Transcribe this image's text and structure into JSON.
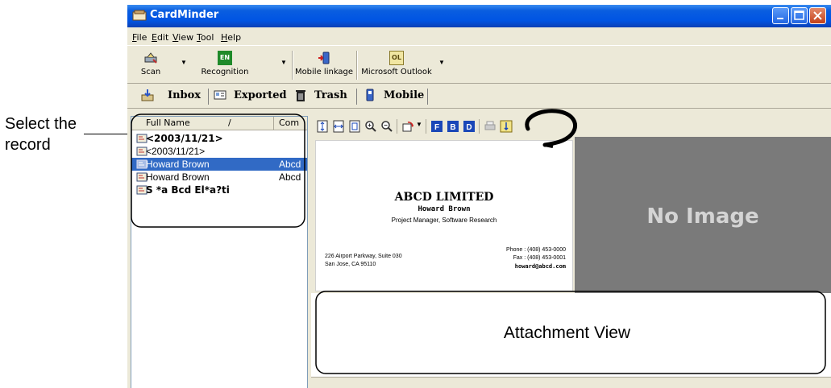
{
  "callout": {
    "label": "Select the record"
  },
  "window": {
    "title": "CardMinder"
  },
  "menu": [
    "File",
    "Edit",
    "View",
    "Tool",
    "Help"
  ],
  "toolbar": {
    "scan": "Scan",
    "recognition": "Recognition",
    "mobile_linkage": "Mobile linkage",
    "outlook": "Microsoft Outlook",
    "recognition_icon_text": "EN",
    "outlook_icon_text": "OL"
  },
  "tabs": [
    "Inbox",
    "Exported",
    "Trash",
    "Mobile"
  ],
  "list": {
    "columns": [
      "Full Name",
      "Com"
    ],
    "rows": [
      {
        "name": "<2003/11/21>",
        "company": "",
        "bold": true
      },
      {
        "name": "<2003/11/21>",
        "company": "",
        "bold": false
      },
      {
        "name": "Howard Brown",
        "company": "Abcd",
        "selected": true
      },
      {
        "name": "Howard Brown",
        "company": "Abcd",
        "bold": false
      },
      {
        "name": "S *a Bcd El*a?ti",
        "company": "",
        "bold": true
      }
    ]
  },
  "card": {
    "company": "ABCD LIMITED",
    "name": "Howard Brown",
    "title": "Project Manager, Software Research",
    "address1": "226 Airport Parkway, Suite 030",
    "address2": "San Jose, CA 95110",
    "phone": "Phone : (408) 453-0000",
    "fax": "Fax : (408) 453-0001",
    "email": "howard@abcd.com"
  },
  "no_image": "No Image",
  "attachment_view": "Attachment View",
  "colors": {
    "titlebar": "#0054e3",
    "selection": "#316ac5",
    "window_bg": "#ece9d8",
    "no_image_bg": "#7a7a7a"
  }
}
